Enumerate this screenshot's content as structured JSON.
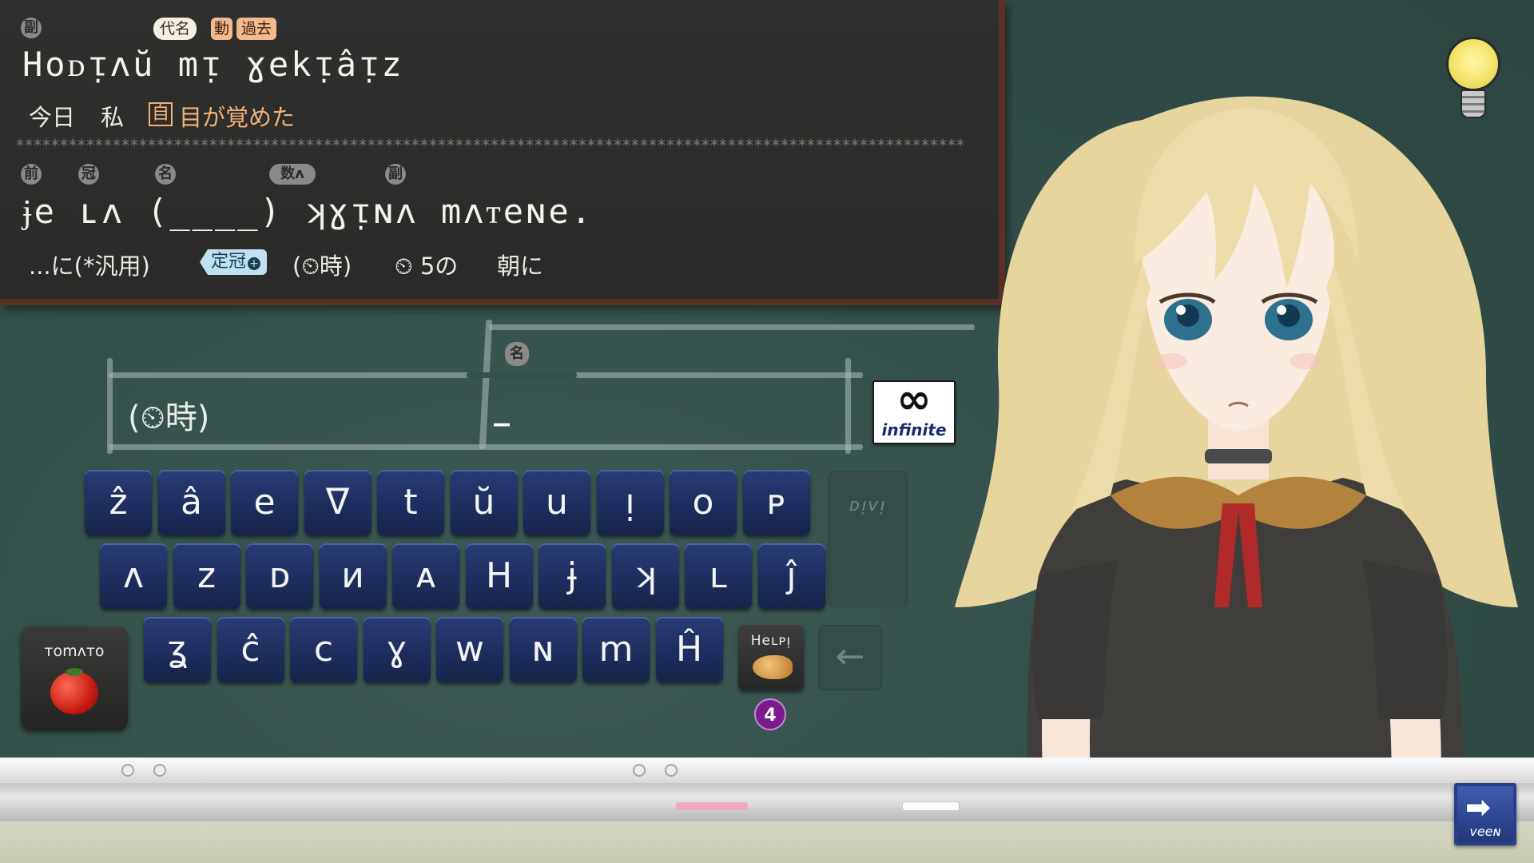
{
  "board": {
    "sentence1": {
      "tags": {
        "adverb": "副",
        "pronoun": "代名",
        "verb": "動",
        "past": "過去"
      },
      "text": "Hoᴅᴉʌŭ mᴉ ɣekᴉâᴉz",
      "translation": {
        "today": "今日",
        "me": "私",
        "intransitive": "自",
        "phrase": "目が覚めた"
      }
    },
    "separator": "************************************************************************************************************",
    "sentence2": {
      "tags": {
        "prep": "前",
        "article": "冠",
        "noun": "名",
        "num": "数ʌ",
        "adverb": "副"
      },
      "text": "ɉe ʟʌ (____) ʞɣᴉɴʌ mʌᴛeɴe.",
      "gloss": {
        "prep": "...に(*汎用)",
        "article": "定冠",
        "time": "(⏲時)",
        "five": "⏲ 5の",
        "morning": "朝に"
      }
    }
  },
  "input": {
    "noun_tag": "名",
    "field_label": "(⏲時)",
    "cursor": "_",
    "infinite_label": "infinite"
  },
  "keyboard": {
    "row1": [
      "ẑ",
      "â",
      "e",
      "ᐁ",
      "t",
      "ŭ",
      "u",
      "ᴉ",
      "o",
      "ᴘ"
    ],
    "row2": [
      "ʌ",
      "z",
      "ᴅ",
      "ᴎ",
      "ᴀ",
      "H",
      "ɉ",
      "ʞ",
      "ʟ",
      "ĵ"
    ],
    "row3": [
      "ʓ",
      "ĉ",
      "c",
      "ɣ",
      "w",
      "ɴ",
      "m",
      "Ĥ"
    ],
    "dini": "ᴅᴉᴠᴉ",
    "tomato_label": "ᴛomʌᴛo",
    "help_label": "Heʟᴘᴉ",
    "help_count": "4",
    "backspace": "←",
    "exit_label": "veeɴ"
  },
  "colors": {
    "board": "#2e2e2c",
    "frame": "#5a2f26",
    "key": "#223066",
    "tag_orange": "#f1b27a",
    "wall": "#34504b"
  }
}
